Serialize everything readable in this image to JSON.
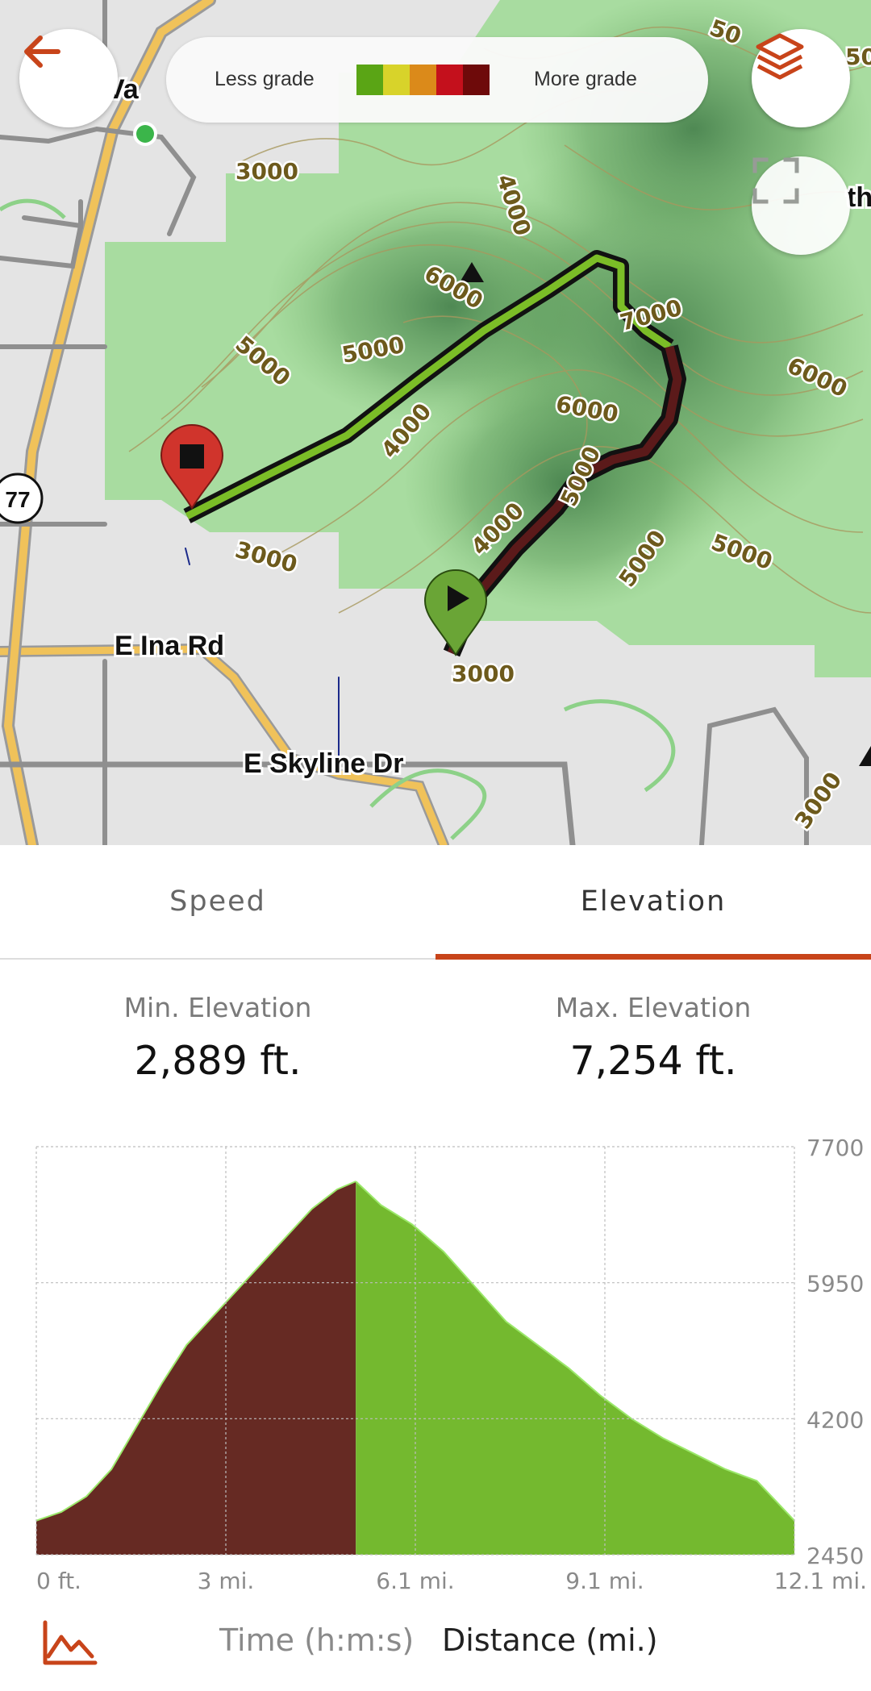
{
  "map": {
    "legend": {
      "less_label": "Less grade",
      "more_label": "More grade",
      "swatches": [
        "#5aa515",
        "#d8d32a",
        "#db8a1a",
        "#c4101c",
        "#6e0a0a"
      ]
    },
    "road_labels": {
      "ina": "E Ina Rd",
      "skyline": "E Skyline Dr",
      "partial_top": "Va",
      "partial_right": "th"
    },
    "highway_shield": "77",
    "contours": {
      "c1": "3000",
      "c2": "4000",
      "c3": "5000",
      "c4": "5000",
      "c5": "6000",
      "c6": "7000",
      "c7": "6000",
      "c8": "4000",
      "c9": "5000",
      "c10": "6000",
      "c11": "4000",
      "c12": "5000",
      "c13": "5000",
      "c14": "3000",
      "c15": "3000",
      "c16": "3000",
      "c17": "50",
      "c18": "50"
    },
    "colors": {
      "route_ascent": "#5b1a1a",
      "route_descent": "#7bbd27",
      "start_pin": "#6aa536",
      "end_pin": "#d0342c",
      "accent": "#c8441a"
    },
    "icons": {
      "back": "arrow-left-icon",
      "layers": "layers-icon",
      "fullscreen": "fullscreen-icon",
      "start": "play-pin-icon",
      "end": "stop-pin-icon"
    }
  },
  "tabs": {
    "speed": "Speed",
    "elevation": "Elevation",
    "active": "elevation"
  },
  "stats": {
    "min_label": "Min. Elevation",
    "min_value": "2,889 ft.",
    "max_label": "Max. Elevation",
    "max_value": "7,254 ft."
  },
  "chart_data": {
    "type": "area",
    "title": "",
    "xlabel": "",
    "ylabel": "",
    "x_ticks": [
      "0 ft.",
      "3 mi.",
      "6.1 mi.",
      "9.1 mi.",
      "12.1 mi."
    ],
    "y_ticks": [
      "7700",
      "5950",
      "4200",
      "2450"
    ],
    "ylim": [
      2450,
      7700
    ],
    "xlim": [
      0,
      12.1
    ],
    "grid": true,
    "series": [
      {
        "color": "#662a23",
        "x": [
          0,
          0.4,
          0.8,
          1.2,
          1.6,
          2.0,
          2.4,
          2.8,
          3.2,
          3.6,
          4.0,
          4.4,
          4.8,
          5.1
        ],
        "values": [
          2889,
          3000,
          3200,
          3550,
          4100,
          4650,
          5150,
          5500,
          5850,
          6200,
          6550,
          6900,
          7150,
          7254
        ]
      },
      {
        "color": "#74b92f",
        "x": [
          5.1,
          5.5,
          6.0,
          6.5,
          7.0,
          7.5,
          8.0,
          8.5,
          9.0,
          9.5,
          10.0,
          10.5,
          11.0,
          11.5,
          12.1
        ],
        "values": [
          7254,
          6950,
          6700,
          6350,
          5900,
          5450,
          5150,
          4850,
          4500,
          4200,
          3950,
          3750,
          3550,
          3400,
          2889
        ]
      }
    ]
  },
  "bottom_bar": {
    "time_label": "Time (h:m:s)",
    "distance_label": "Distance (mi.)",
    "chart_icon": "area-chart-icon"
  }
}
